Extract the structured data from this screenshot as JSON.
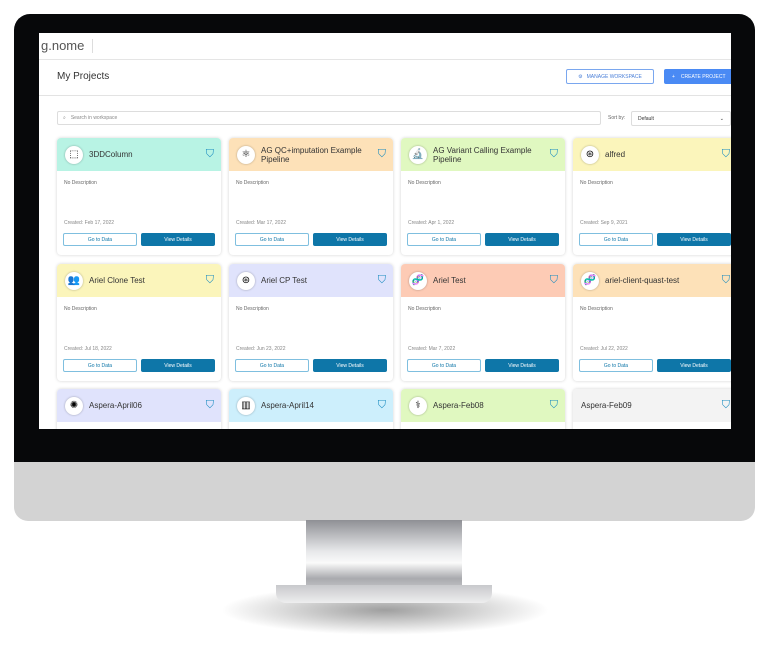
{
  "app": {
    "logo": "g.nome"
  },
  "header": {
    "title": "My Projects",
    "manage_label": "MANAGE WORKSPACE",
    "create_label": "CREATE PROJECT"
  },
  "toolbar": {
    "search_placeholder": "Search in workspace",
    "sort_label": "Sort by:",
    "sort_value": "Default"
  },
  "projects": [
    {
      "name": "3DDColumn",
      "color": "#b8f3e4",
      "icon": "column-icon",
      "glyph": "⬚",
      "description": "No Description",
      "created": "Created: Feb 17, 2022"
    },
    {
      "name": "AG QC+imputation Example Pipeline",
      "color": "#fde1b8",
      "icon": "molecule-icon",
      "glyph": "⚛",
      "description": "No Description",
      "created": "Created: Mar 17, 2022"
    },
    {
      "name": "AG Variant Calling Example Pipeline",
      "color": "#e0f8c0",
      "icon": "microscope-icon",
      "glyph": "🔬",
      "description": "No Description",
      "created": "Created: Apr 1, 2022"
    },
    {
      "name": "alfred",
      "color": "#fbf5bb",
      "icon": "virus-search-icon",
      "glyph": "⊛",
      "description": "No Description",
      "created": "Created: Sep 9, 2021"
    },
    {
      "name": "Ariel Clone Test",
      "color": "#fbf5bb",
      "icon": "people-icon",
      "glyph": "👥",
      "description": "No Description",
      "created": "Created: Jul 18, 2022"
    },
    {
      "name": "Ariel CP Test",
      "color": "#e0e3fc",
      "icon": "virus-search-icon",
      "glyph": "⊛",
      "description": "No Description",
      "created": "Created: Jun 23, 2022"
    },
    {
      "name": "Ariel Test",
      "color": "#fdcbb5",
      "icon": "dna-icon",
      "glyph": "🧬",
      "description": "No Description",
      "created": "Created: Mar 7, 2022"
    },
    {
      "name": "ariel-client-quast-test",
      "color": "#fde1b8",
      "icon": "dna-icon",
      "glyph": "🧬",
      "description": "No Description",
      "created": "Created: Jul 22, 2022"
    },
    {
      "name": "Aspera-April06",
      "color": "#e0e3fc",
      "icon": "bacteria-icon",
      "glyph": "✺",
      "description": "",
      "created": ""
    },
    {
      "name": "Aspera-April14",
      "color": "#cdeffc",
      "icon": "test-tubes-icon",
      "glyph": "▥",
      "description": "",
      "created": ""
    },
    {
      "name": "Aspera-Feb08",
      "color": "#e0f8c0",
      "icon": "caduceus-icon",
      "glyph": "⚕",
      "description": "",
      "created": ""
    },
    {
      "name": "Aspera-Feb09",
      "color": "#f3f3f3",
      "icon": "",
      "glyph": "",
      "description": "",
      "created": ""
    }
  ],
  "card_actions": {
    "go_to_data": "Go to Data",
    "view_details": "View Details"
  }
}
